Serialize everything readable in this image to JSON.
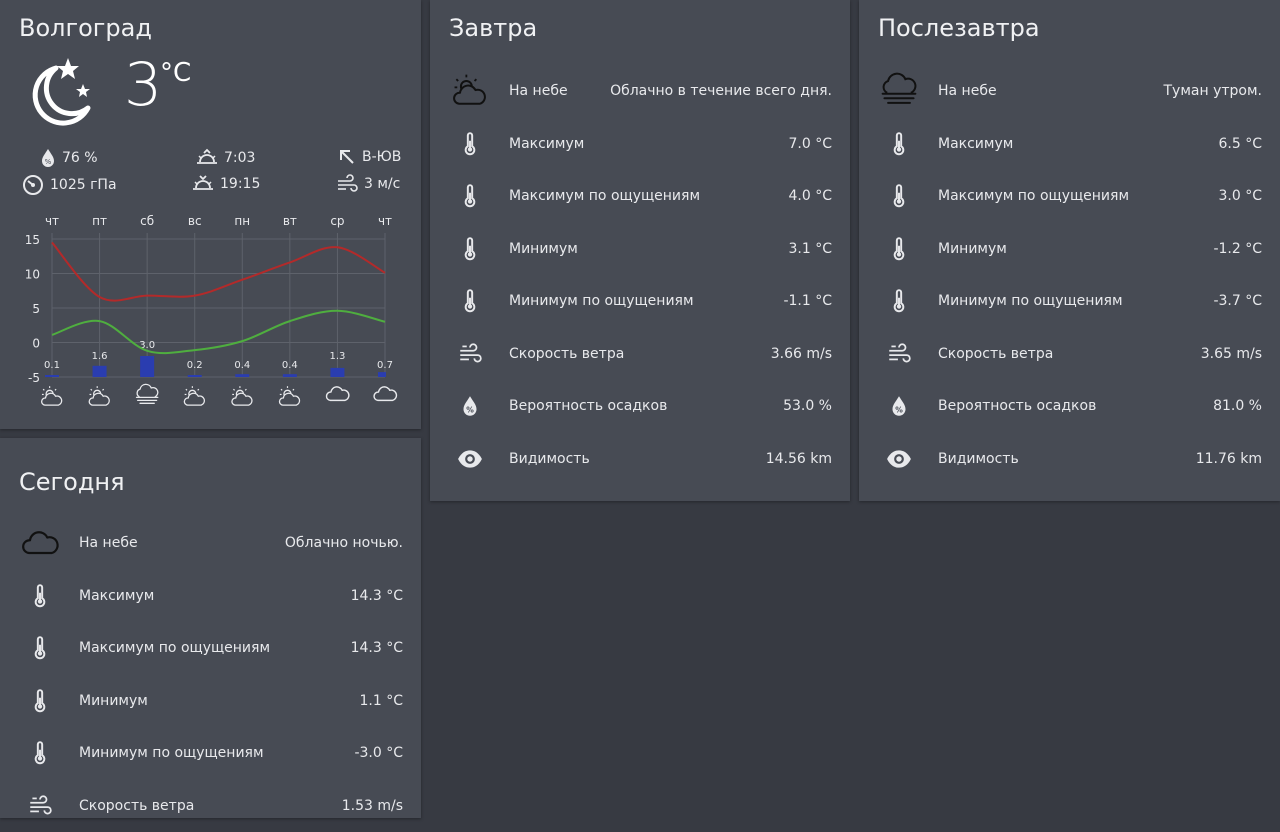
{
  "current": {
    "city": "Волгоград",
    "temp": "3",
    "unit": "°C",
    "condition_icon": "moon-stars-icon",
    "humidity": "76 %",
    "pressure": "1025 гПа",
    "sunrise": "7:03",
    "sunset": "19:15",
    "wind_dir": "В-ЮВ",
    "wind_speed": "3 м/с"
  },
  "chart_data": {
    "type": "line",
    "categories": [
      "чт",
      "пт",
      "сб",
      "вс",
      "пн",
      "вт",
      "ср",
      "чт"
    ],
    "ylim": [
      -5,
      15
    ],
    "yticks": [
      "15",
      "10",
      "5",
      "0",
      "-5"
    ],
    "series": [
      {
        "color": "#b32a2a",
        "values": [
          14.5,
          6.6,
          6.8,
          6.8,
          9.1,
          11.6,
          13.8,
          10.1
        ]
      },
      {
        "color": "#4fae3f",
        "values": [
          1.1,
          3.1,
          -1.2,
          -1.1,
          0.2,
          3.1,
          4.6,
          3.0
        ]
      }
    ],
    "precipitation": [
      {
        "label": "0.1",
        "value": 0.1
      },
      {
        "label": "1.6",
        "value": 1.6
      },
      {
        "label": "3.0",
        "value": 3.0
      },
      {
        "label": "0.2",
        "value": 0.2
      },
      {
        "label": "0.4",
        "value": 0.4
      },
      {
        "label": "0.4",
        "value": 0.4
      },
      {
        "label": "1.3",
        "value": 1.3
      },
      {
        "label": "0.7",
        "value": 0.7
      }
    ],
    "precip_color": "#2a3db0",
    "daily_icons": [
      "cloudy-sun-icon",
      "cloudy-sun-icon",
      "fog-icon",
      "cloudy-sun-icon",
      "cloudy-sun-icon",
      "cloudy-sun-icon",
      "cloud-icon",
      "cloud-icon"
    ]
  },
  "today": {
    "title": "Сегодня",
    "rows": [
      {
        "icon": "cloud-icon",
        "label": "На небе",
        "value": "Облачно ночью."
      },
      {
        "icon": "thermometer-icon",
        "label": "Максимум",
        "value": "14.3 °C"
      },
      {
        "icon": "thermometer-icon",
        "label": "Максимум по ощущениям",
        "value": "14.3 °C"
      },
      {
        "icon": "thermometer-icon",
        "label": "Минимум",
        "value": "1.1 °C"
      },
      {
        "icon": "thermometer-icon",
        "label": "Минимум по ощущениям",
        "value": "-3.0 °C"
      },
      {
        "icon": "wind-icon",
        "label": "Скорость ветра",
        "value": "1.53 m/s"
      }
    ]
  },
  "tomorrow": {
    "title": "Завтра",
    "rows": [
      {
        "icon": "cloudy-sun-icon",
        "label": "На небе",
        "value": "Облачно в течение всего дня."
      },
      {
        "icon": "thermometer-icon",
        "label": "Максимум",
        "value": "7.0 °C"
      },
      {
        "icon": "thermometer-icon",
        "label": "Максимум по ощущениям",
        "value": "4.0 °C"
      },
      {
        "icon": "thermometer-icon",
        "label": "Минимум",
        "value": "3.1 °C"
      },
      {
        "icon": "thermometer-icon",
        "label": "Минимум по ощущениям",
        "value": "-1.1 °C"
      },
      {
        "icon": "wind-icon",
        "label": "Скорость ветра",
        "value": "3.66 m/s"
      },
      {
        "icon": "precipitation-icon",
        "label": "Вероятность осадков",
        "value": "53.0 %"
      },
      {
        "icon": "eye-icon",
        "label": "Видимость",
        "value": "14.56 km"
      }
    ]
  },
  "after_tomorrow": {
    "title": "Послезавтра",
    "rows": [
      {
        "icon": "fog-icon",
        "label": "На небе",
        "value": "Туман утром."
      },
      {
        "icon": "thermometer-icon",
        "label": "Максимум",
        "value": "6.5 °C"
      },
      {
        "icon": "thermometer-icon",
        "label": "Максимум по ощущениям",
        "value": "3.0 °C"
      },
      {
        "icon": "thermometer-icon",
        "label": "Минимум",
        "value": "-1.2 °C"
      },
      {
        "icon": "thermometer-icon",
        "label": "Минимум по ощущениям",
        "value": "-3.7 °C"
      },
      {
        "icon": "wind-icon",
        "label": "Скорость ветра",
        "value": "3.65 m/s"
      },
      {
        "icon": "precipitation-icon",
        "label": "Вероятность осадков",
        "value": "81.0 %"
      },
      {
        "icon": "eye-icon",
        "label": "Видимость",
        "value": "11.76 km"
      }
    ]
  }
}
